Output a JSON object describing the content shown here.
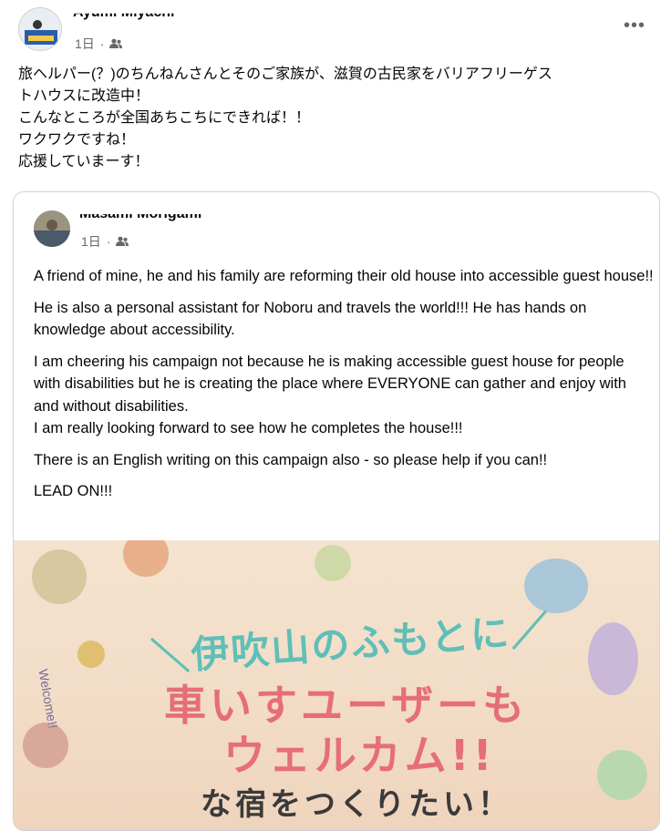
{
  "post": {
    "author": "Ayumi Miyachi",
    "time": "1日",
    "audience_icon": "friends-icon",
    "more_label": "•••",
    "text_lines": [
      "旅ヘルパー(？)のちんねんさんとそのご家族が、滋賀の古民家をバリアフリーゲス",
      "トハウスに改造中！",
      "こんなところが全国あちこちにできれば！！",
      "ワクワクですね！",
      "応援していまーす！"
    ]
  },
  "shared": {
    "author": "Masami Morigami",
    "time": "1日",
    "audience_icon": "friends-icon",
    "p1": "A friend of mine, he and his family are reforming their old house into accessible guest house!!",
    "p2": "He is also a personal assistant for Noboru and travels the world!!!  He has hands on knowledge about accessibility.",
    "p3a": "I am cheering his campaign not because he is making accessible guest house for people with disabilities but he is creating the place where EVERYONE can gather and enjoy with and without disabilities.",
    "p3b": "I am really looking forward to see how he completes the house!!!",
    "p4": "There is an English writing on this campaign also - so please help if you can!!",
    "p5": "LEAD ON!!!",
    "image": {
      "line1": "＼伊吹山のふもとに／",
      "line2": "車いすユーザーも",
      "line3": "ウェルカム!!",
      "line4": "な宿をつくりたい！",
      "ribbon": "Welcome!!"
    }
  },
  "colors": {
    "meta": "#65676b",
    "teal": "#5fbfb8",
    "pink": "#e56e79",
    "border": "#cfd3d8"
  }
}
